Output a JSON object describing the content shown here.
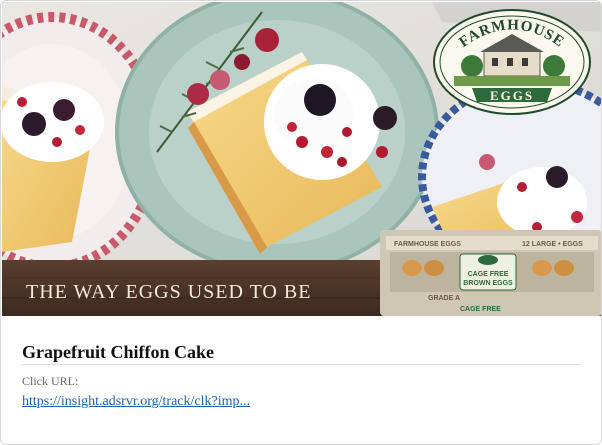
{
  "ad": {
    "tagline": "THE WAY EGGS USED TO BE",
    "logo": {
      "top": "FARMHOUSE",
      "bottom": "EGGS"
    },
    "carton": {
      "brand": "FARMHOUSE EGGS",
      "count": "12 LARGE • EGGS",
      "label_lines": [
        "CAGE FREE",
        "BROWN EGGS"
      ],
      "grade": "GRADE A",
      "footer": "CAGE FREE"
    }
  },
  "title": "Grapefruit Chiffon Cake",
  "click_url_label": "Click URL:",
  "click_url": "https://insight.adsrvr.org/track/clk?imp..."
}
